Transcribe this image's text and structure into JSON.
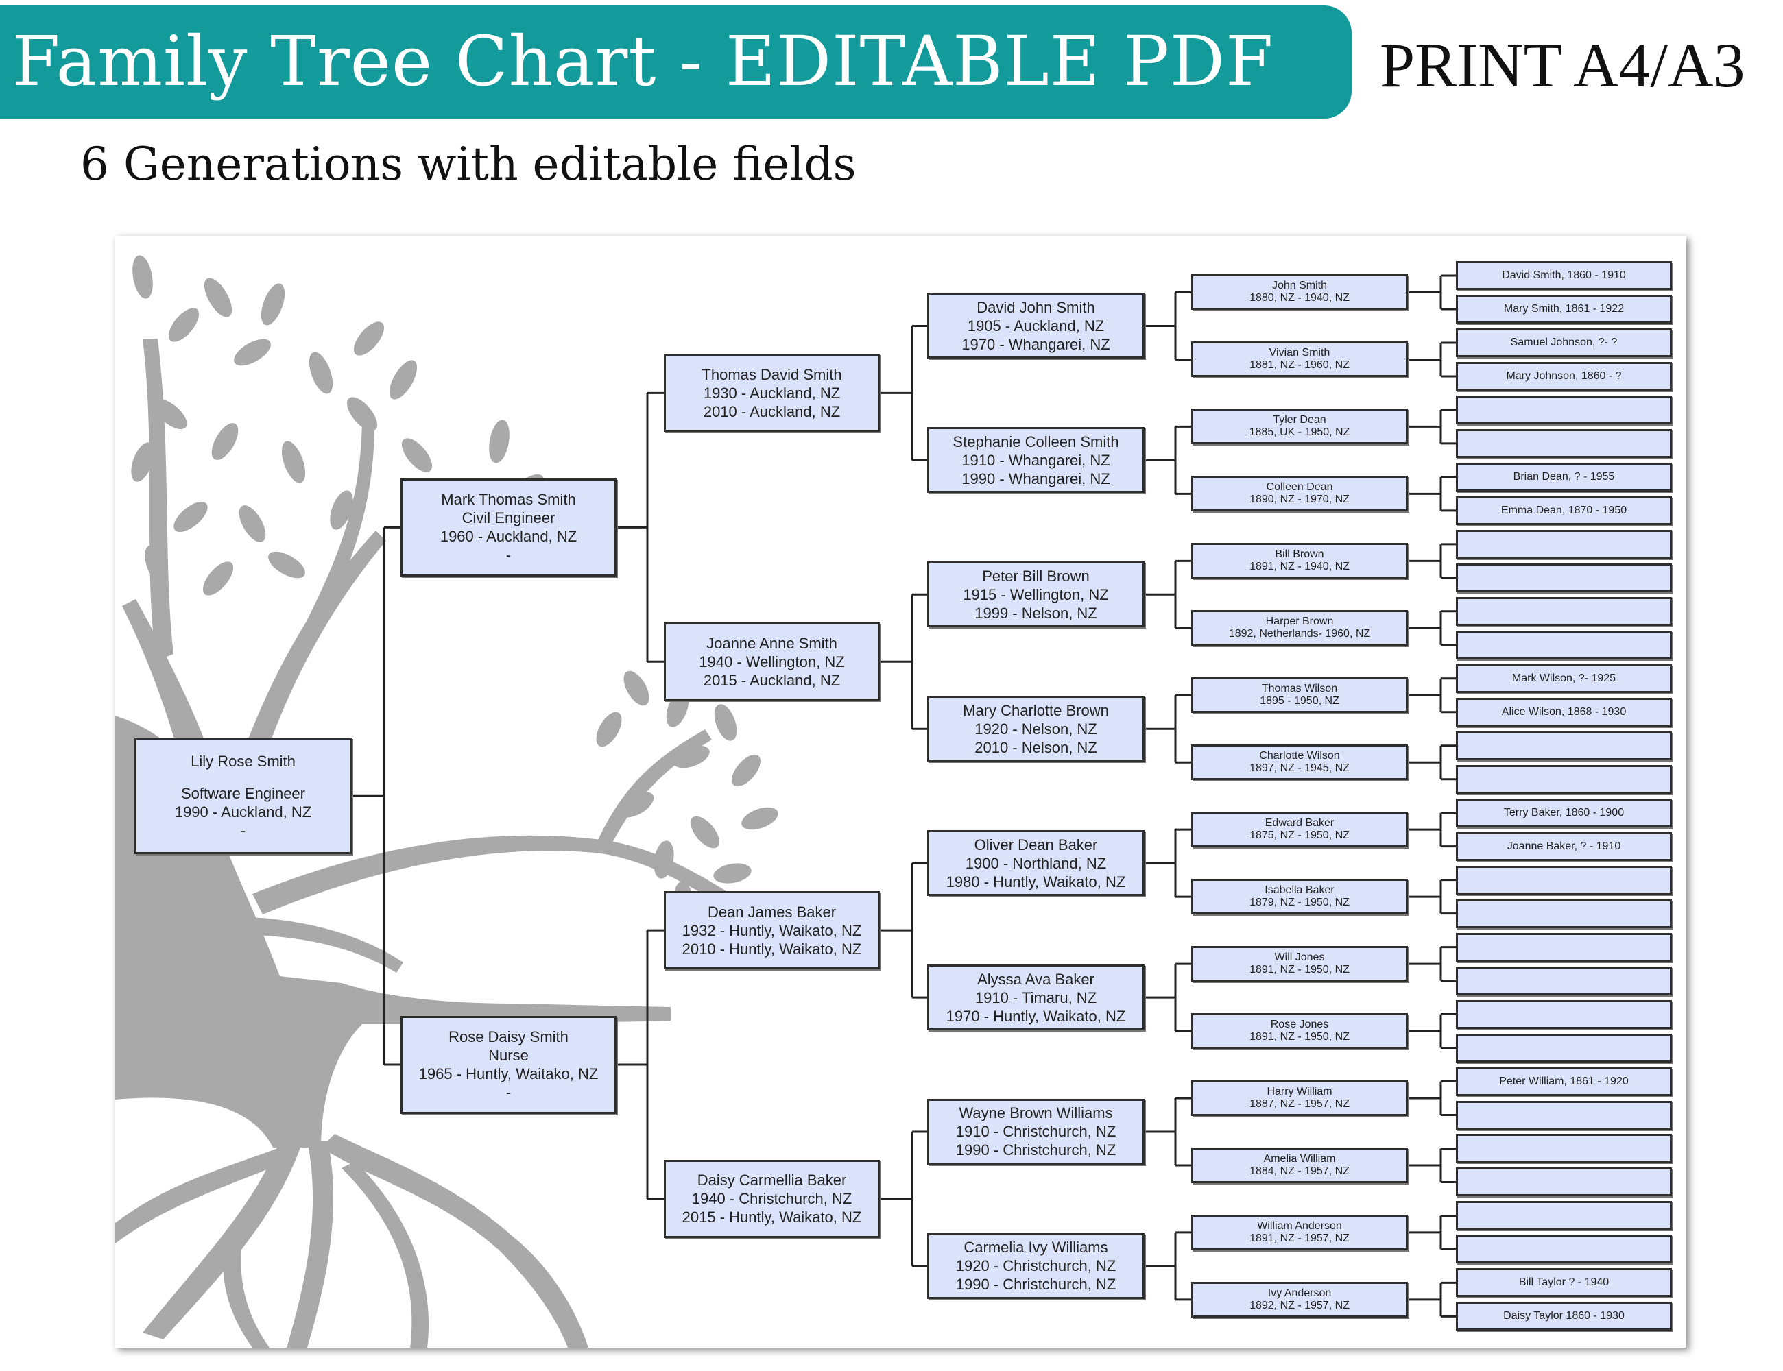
{
  "header": {
    "title": "Family Tree Chart - EDITABLE PDF",
    "print_label": "PRINT A4/A3",
    "subtitle": "6 Generations with editable fields",
    "accent_color": "#139a9b"
  },
  "chart": {
    "box_fill": "#dbe3fb",
    "tree_color": "#a9a9a9",
    "generations": [
      [
        [
          "Lily Rose Smith",
          "",
          "Software Engineer",
          "1990 - Auckland, NZ",
          "-"
        ]
      ],
      [
        [
          "Mark Thomas Smith",
          "Civil Engineer",
          "1960 - Auckland, NZ",
          "-"
        ],
        [
          "Rose Daisy Smith",
          "Nurse",
          "1965 - Huntly, Waitako, NZ",
          "-"
        ]
      ],
      [
        [
          "Thomas David Smith",
          "1930 - Auckland, NZ",
          "2010 - Auckland, NZ"
        ],
        [
          "Joanne Anne Smith",
          "1940 - Wellington, NZ",
          "2015 - Auckland, NZ"
        ],
        [
          "Dean James Baker",
          "1932 - Huntly, Waikato, NZ",
          "2010 - Huntly, Waikato, NZ"
        ],
        [
          "Daisy Carmellia Baker",
          "1940 - Christchurch, NZ",
          "2015 - Huntly, Waikato, NZ"
        ]
      ],
      [
        [
          "David John Smith",
          "1905 - Auckland, NZ",
          "1970 - Whangarei, NZ"
        ],
        [
          "Stephanie Colleen Smith",
          "1910 - Whangarei, NZ",
          "1990 - Whangarei, NZ"
        ],
        [
          "Peter Bill Brown",
          "1915 - Wellington, NZ",
          "1999 - Nelson, NZ"
        ],
        [
          "Mary Charlotte Brown",
          "1920 - Nelson, NZ",
          "2010 - Nelson, NZ"
        ],
        [
          "Oliver Dean Baker",
          "1900 - Northland, NZ",
          "1980 - Huntly, Waikato, NZ"
        ],
        [
          "Alyssa Ava Baker",
          "1910 - Timaru, NZ",
          "1970 - Huntly, Waikato, NZ"
        ],
        [
          "Wayne Brown Williams",
          "1910 - Christchurch, NZ",
          "1990 - Christchurch, NZ"
        ],
        [
          "Carmelia Ivy Williams",
          "1920 - Christchurch, NZ",
          "1990 - Christchurch, NZ"
        ]
      ],
      [
        [
          "John Smith",
          "1880, NZ - 1940, NZ"
        ],
        [
          "Vivian Smith",
          "1881, NZ - 1960, NZ"
        ],
        [
          "Tyler Dean",
          "1885, UK - 1950, NZ"
        ],
        [
          "Colleen Dean",
          "1890, NZ - 1970, NZ"
        ],
        [
          "Bill Brown",
          "1891, NZ - 1940, NZ"
        ],
        [
          "Harper Brown",
          "1892, Netherlands- 1960, NZ"
        ],
        [
          "Thomas Wilson",
          "1895 - 1950, NZ"
        ],
        [
          "Charlotte Wilson",
          "1897, NZ - 1945, NZ"
        ],
        [
          "Edward Baker",
          "1875, NZ - 1950, NZ"
        ],
        [
          "Isabella Baker",
          "1879, NZ - 1950, NZ"
        ],
        [
          "Will Jones",
          "1891, NZ - 1950, NZ"
        ],
        [
          "Rose Jones",
          "1891, NZ - 1950, NZ"
        ],
        [
          "Harry William",
          "1887, NZ - 1957, NZ"
        ],
        [
          "Amelia William",
          "1884, NZ - 1957, NZ"
        ],
        [
          "William Anderson",
          "1891, NZ - 1957, NZ"
        ],
        [
          "Ivy Anderson",
          "1892, NZ - 1957, NZ"
        ]
      ],
      [
        [
          "David Smith, 1860 - 1910"
        ],
        [
          "Mary Smith, 1861 - 1922"
        ],
        [
          "Samuel Johnson, ?- ?"
        ],
        [
          "Mary Johnson, 1860 - ?"
        ],
        [
          ""
        ],
        [
          ""
        ],
        [
          "Brian Dean, ? - 1955"
        ],
        [
          "Emma Dean, 1870 - 1950"
        ],
        [
          ""
        ],
        [
          ""
        ],
        [
          ""
        ],
        [
          ""
        ],
        [
          "Mark Wilson, ?- 1925"
        ],
        [
          "Alice Wilson, 1868 - 1930"
        ],
        [
          ""
        ],
        [
          ""
        ],
        [
          "Terry Baker, 1860 - 1900"
        ],
        [
          "Joanne Baker, ? - 1910"
        ],
        [
          ""
        ],
        [
          ""
        ],
        [
          ""
        ],
        [
          ""
        ],
        [
          ""
        ],
        [
          ""
        ],
        [
          "Peter William, 1861 - 1920"
        ],
        [
          ""
        ],
        [
          ""
        ],
        [
          ""
        ],
        [
          ""
        ],
        [
          ""
        ],
        [
          "Bill Taylor ? - 1940"
        ],
        [
          "Daisy Taylor 1860 - 1930"
        ]
      ]
    ]
  }
}
